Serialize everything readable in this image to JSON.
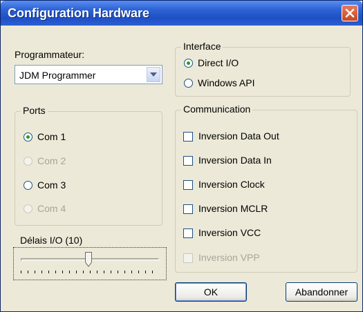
{
  "window": {
    "title": "Configuration Hardware"
  },
  "programmer": {
    "label": "Programmateur:",
    "selected": "JDM Programmer"
  },
  "ports": {
    "legend": "Ports",
    "items": [
      {
        "label": "Com 1",
        "checked": true,
        "enabled": true
      },
      {
        "label": "Com 2",
        "checked": false,
        "enabled": false
      },
      {
        "label": "Com 3",
        "checked": false,
        "enabled": true
      },
      {
        "label": "Com 4",
        "checked": false,
        "enabled": false
      }
    ]
  },
  "delay": {
    "label": "Délais I/O  (10)",
    "value": 10
  },
  "interface": {
    "legend": "Interface",
    "options": [
      {
        "label": "Direct I/O",
        "checked": true
      },
      {
        "label": "Windows API",
        "checked": false
      }
    ]
  },
  "communication": {
    "legend": "Communication",
    "items": [
      {
        "label": "Inversion Data Out",
        "checked": false,
        "enabled": true
      },
      {
        "label": "Inversion Data In",
        "checked": false,
        "enabled": true
      },
      {
        "label": "Inversion Clock",
        "checked": false,
        "enabled": true
      },
      {
        "label": "Inversion MCLR",
        "checked": false,
        "enabled": true
      },
      {
        "label": "Inversion VCC",
        "checked": false,
        "enabled": true
      },
      {
        "label": "Inversion VPP",
        "checked": false,
        "enabled": false
      }
    ]
  },
  "buttons": {
    "ok": "OK",
    "cancel": "Abandonner"
  }
}
